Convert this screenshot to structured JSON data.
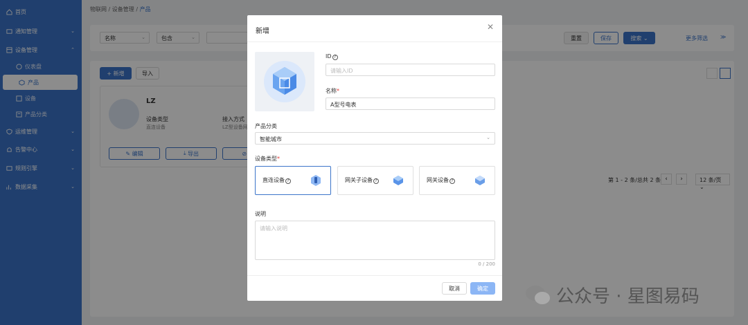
{
  "sidebar": {
    "items": [
      {
        "label": "首页",
        "icon": "home-icon",
        "has_chevron": false
      },
      {
        "label": "通知管理",
        "icon": "bell-icon",
        "has_chevron": true
      },
      {
        "label": "设备管理",
        "icon": "device-icon",
        "has_chevron": true,
        "expanded": true
      },
      {
        "label": "仪表盘",
        "icon": "dashboard-icon",
        "sub": true
      },
      {
        "label": "产品",
        "icon": "product-icon",
        "sub": true,
        "active": true
      },
      {
        "label": "设备",
        "icon": "device-sub-icon",
        "sub": true
      },
      {
        "label": "产品分类",
        "icon": "category-icon",
        "sub": true
      },
      {
        "label": "运维管理",
        "icon": "shield-icon",
        "has_chevron": true
      },
      {
        "label": "告警中心",
        "icon": "alarm-icon",
        "has_chevron": true
      },
      {
        "label": "规则引擎",
        "icon": "rule-icon",
        "has_chevron": true
      },
      {
        "label": "数据采集",
        "icon": "data-icon",
        "has_chevron": true
      }
    ]
  },
  "breadcrumb": {
    "items": [
      "物联网",
      "设备管理",
      "产品"
    ],
    "sep": "/"
  },
  "filter": {
    "field_select": "名称",
    "op_select": "包含",
    "reset": "重置",
    "save": "保存",
    "search": "搜索",
    "more": "更多筛选"
  },
  "list": {
    "add_button": "新增",
    "import_button": "导入",
    "card": {
      "name": "LZ",
      "type_label": "设备类型",
      "type_value": "直连设备",
      "access_label": "接入方式",
      "access_value": "LZ型设备网",
      "edit": "编辑",
      "export": "导出",
      "disable": "禁"
    },
    "pagination": {
      "summary": "第 1 - 2 条/总共 2 条",
      "page_size": "12 条/页"
    }
  },
  "modal": {
    "title": "新增",
    "id_label": "ID",
    "id_placeholder": "请输入ID",
    "name_label": "名称",
    "name_value": "A型号电表",
    "category_label": "产品分类",
    "category_value": "智能城市",
    "device_type_label": "设备类型",
    "device_types": [
      {
        "label": "直连设备",
        "selected": true
      },
      {
        "label": "网关子设备",
        "selected": false
      },
      {
        "label": "网关设备",
        "selected": false
      }
    ],
    "desc_label": "说明",
    "desc_placeholder": "请输入说明",
    "counter": "0 / 200",
    "cancel": "取消",
    "confirm": "确定"
  },
  "watermark": "公众号 · 星图易码",
  "colors": {
    "brand": "#3b74c9",
    "required": "#e53935"
  }
}
